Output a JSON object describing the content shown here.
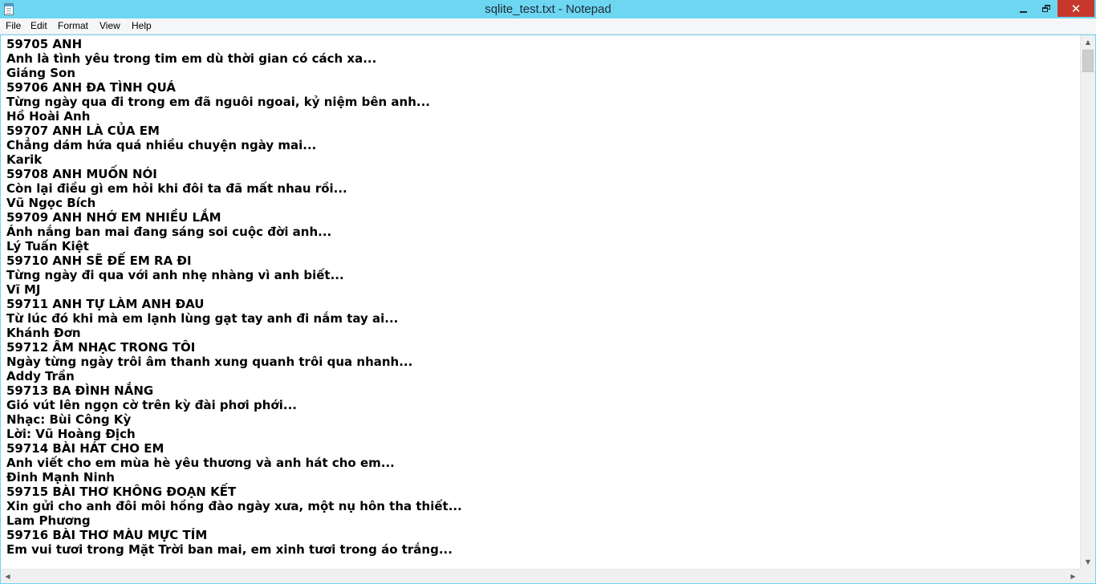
{
  "window": {
    "title": "sqlite_test.txt - Notepad"
  },
  "menu": {
    "file": "File",
    "edit": "Edit",
    "format": "Format",
    "view": "View",
    "help": "Help"
  },
  "editor": {
    "lines": [
      "59705 ANH",
      "Anh là tình yêu trong tim em dù thời gian có cách xa...",
      "Giáng Son",
      "59706 ANH ĐA TÌNH QUÁ",
      "Từng ngày qua đi trong em đã nguôi ngoai, kỷ niệm bên anh...",
      "Hồ Hoài Anh",
      "59707 ANH LÀ CỦA EM",
      "Chẳng dám hứa quá nhiều chuyện ngày mai...",
      "Karik",
      "59708 ANH MUỐN NÓI",
      "Còn lại điều gì em hỏi khi đôi ta đã mất nhau rồi...",
      "Vũ Ngọc Bích",
      "59709 ANH NHỚ EM NHIỀU LẮM",
      "Ánh nắng ban mai đang sáng soi cuộc đời anh...",
      "Lý Tuấn Kiệt",
      "59710 ANH SẼ ĐẾ EM RA ĐI",
      "Từng ngày đi qua với anh nhẹ nhàng vì anh biết...",
      "Vĩ MJ",
      "59711 ANH TỰ LÀM ANH ĐAU",
      "Từ lúc đó khi mà em lạnh lùng gạt tay anh đi nắm tay ai...",
      "Khánh Đơn",
      "59712 ÂM NHẠC TRONG TÔI",
      "Ngày từng ngày trôi âm thanh xung quanh trôi qua nhanh...",
      "Addy Trần",
      "59713 BA ĐÌNH NẮNG",
      "Gió vút lên ngọn cờ trên kỳ đài phơi phới...",
      "Nhạc: Bùi Công Kỳ",
      "Lời: Vũ Hoàng Địch",
      "59714 BÀI HÁT CHO EM",
      "Anh viết cho em mùa hè yêu thương và anh hát cho em...",
      "Đinh Mạnh Ninh",
      "59715 BÀI THƠ KHÔNG ĐOẠN KẾT",
      "Xin gửi cho anh đôi môi hồng đào ngày xưa, một nụ hôn tha thiết...",
      "Lam Phương",
      "59716 BÀI THƠ MÀU MỰC TÍM",
      "Em vui tươi trong Mặt Trời ban mai, em xinh tươi trong áo trắng..."
    ]
  },
  "icons": {
    "app": "notepad-icon",
    "minimize": "minimize-icon",
    "maximize": "restore-icon",
    "close": "close-icon"
  },
  "colors": {
    "titlebar": "#6dd6f1",
    "close_button": "#c7382c",
    "menubar": "#f5f6f7"
  }
}
